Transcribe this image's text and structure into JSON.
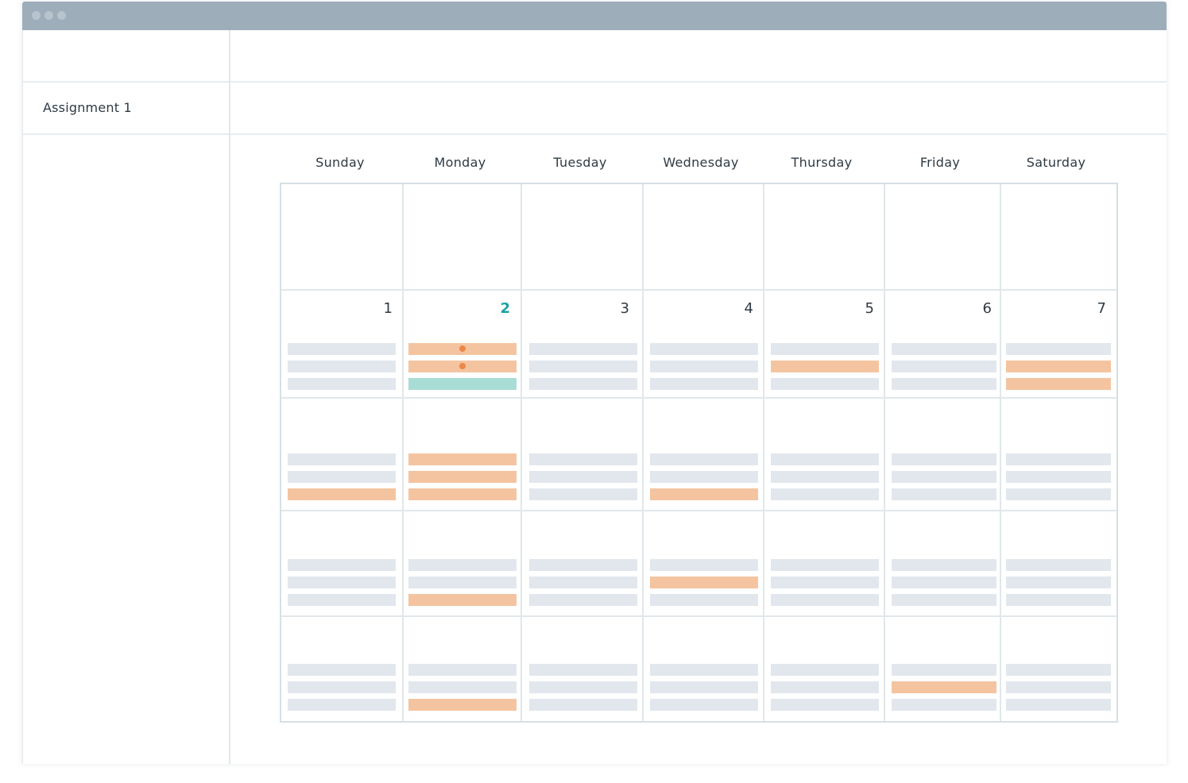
{
  "sidebar": {
    "items": [
      {
        "label": "Assignment 1"
      }
    ]
  },
  "calendar": {
    "day_names": [
      "Sunday",
      "Monday",
      "Tuesday",
      "Wednesday",
      "Thursday",
      "Friday",
      "Saturday"
    ],
    "dates": [
      "1",
      "2",
      "3",
      "4",
      "5",
      "6",
      "7"
    ],
    "today": "2"
  },
  "colors": {
    "titlebar": "#9eadba",
    "today_accent": "#1aa3a3",
    "event_orange": "#f4c4a0",
    "event_teal": "#a8ddd6",
    "placeholder_bar": "#e2e7ed"
  }
}
